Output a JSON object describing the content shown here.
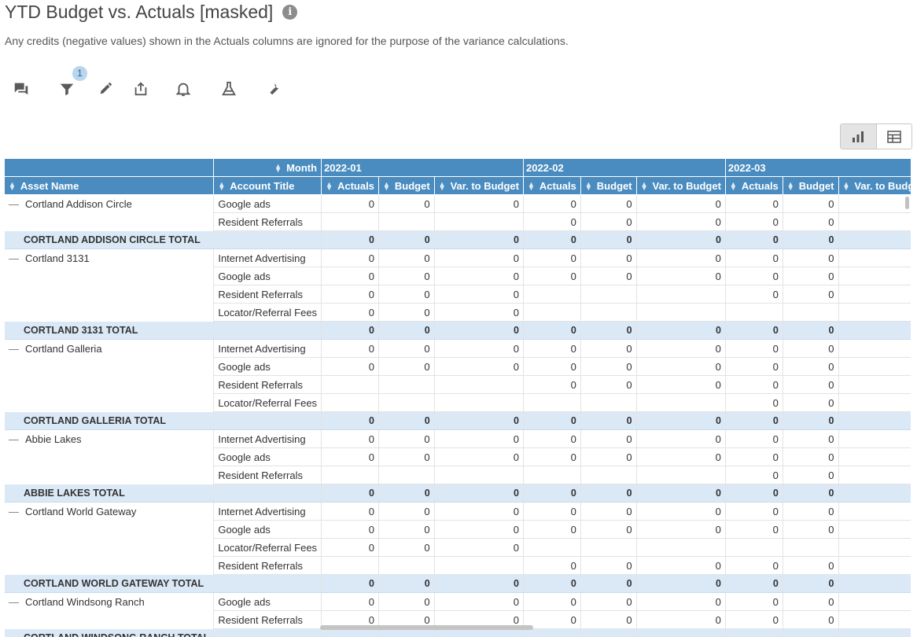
{
  "header": {
    "title": "YTD Budget vs. Actuals [masked]",
    "info_icon": "info-icon",
    "subtitle": "Any credits (negative values) shown in the Actuals columns are ignored for the purpose of the variance calculations."
  },
  "toolbar": {
    "items": [
      {
        "name": "comments-icon"
      },
      {
        "name": "filter-icon"
      },
      {
        "name": "edit-pencil-icon"
      },
      {
        "name": "export-share-icon"
      },
      {
        "name": "alert-bell-icon"
      },
      {
        "name": "lab-flask-icon"
      },
      {
        "name": "settings-wrench-icon"
      }
    ],
    "filter_count": "1"
  },
  "view_toggle": {
    "options": [
      "chart-view-icon",
      "table-view-icon"
    ],
    "active": "chart-view-icon"
  },
  "grid": {
    "pivot_label": "Month",
    "asset_header": "Asset Name",
    "account_header": "Account Title",
    "periods": [
      "2022-01",
      "2022-02",
      "2022-03"
    ],
    "measures": [
      "Actuals",
      "Budget",
      "Var. to Budget"
    ],
    "rows": [
      {
        "asset": "Cortland Addison Circle",
        "account": "Google ads",
        "values": [
          "0",
          "0",
          "0",
          "0",
          "0",
          "0",
          "0",
          "0",
          ""
        ]
      },
      {
        "asset": "",
        "account": "Resident Referrals",
        "values": [
          "",
          "",
          "",
          "0",
          "0",
          "0",
          "0",
          "0",
          ""
        ]
      },
      {
        "total": true,
        "asset": "CORTLAND ADDISON CIRCLE TOTAL",
        "values": [
          "0",
          "0",
          "0",
          "0",
          "0",
          "0",
          "0",
          "0",
          ""
        ]
      },
      {
        "asset": "Cortland 3131",
        "account": "Internet Advertising",
        "values": [
          "0",
          "0",
          "0",
          "0",
          "0",
          "0",
          "0",
          "0",
          ""
        ]
      },
      {
        "asset": "",
        "account": "Google ads",
        "values": [
          "0",
          "0",
          "0",
          "0",
          "0",
          "0",
          "0",
          "0",
          ""
        ]
      },
      {
        "asset": "",
        "account": "Resident Referrals",
        "values": [
          "0",
          "0",
          "0",
          "",
          "",
          "",
          "0",
          "0",
          ""
        ]
      },
      {
        "asset": "",
        "account": "Locator/Referral Fees",
        "values": [
          "0",
          "0",
          "0",
          "",
          "",
          "",
          "",
          "",
          ""
        ]
      },
      {
        "total": true,
        "asset": "CORTLAND 3131 TOTAL",
        "values": [
          "0",
          "0",
          "0",
          "0",
          "0",
          "0",
          "0",
          "0",
          ""
        ]
      },
      {
        "asset": "Cortland Galleria",
        "account": "Internet Advertising",
        "values": [
          "0",
          "0",
          "0",
          "0",
          "0",
          "0",
          "0",
          "0",
          ""
        ]
      },
      {
        "asset": "",
        "account": "Google ads",
        "values": [
          "0",
          "0",
          "0",
          "0",
          "0",
          "0",
          "0",
          "0",
          ""
        ]
      },
      {
        "asset": "",
        "account": "Resident Referrals",
        "values": [
          "",
          "",
          "",
          "0",
          "0",
          "0",
          "0",
          "0",
          ""
        ]
      },
      {
        "asset": "",
        "account": "Locator/Referral Fees",
        "values": [
          "",
          "",
          "",
          "",
          "",
          "",
          "0",
          "0",
          ""
        ]
      },
      {
        "total": true,
        "asset": "CORTLAND GALLERIA TOTAL",
        "values": [
          "0",
          "0",
          "0",
          "0",
          "0",
          "0",
          "0",
          "0",
          ""
        ]
      },
      {
        "asset": "Abbie Lakes",
        "account": "Internet Advertising",
        "values": [
          "0",
          "0",
          "0",
          "0",
          "0",
          "0",
          "0",
          "0",
          ""
        ]
      },
      {
        "asset": "",
        "account": "Google ads",
        "values": [
          "0",
          "0",
          "0",
          "0",
          "0",
          "0",
          "0",
          "0",
          ""
        ]
      },
      {
        "asset": "",
        "account": "Resident Referrals",
        "values": [
          "",
          "",
          "",
          "",
          "",
          "",
          "0",
          "0",
          ""
        ]
      },
      {
        "total": true,
        "asset": "ABBIE LAKES TOTAL",
        "values": [
          "0",
          "0",
          "0",
          "0",
          "0",
          "0",
          "0",
          "0",
          ""
        ]
      },
      {
        "asset": "Cortland World Gateway",
        "account": "Internet Advertising",
        "values": [
          "0",
          "0",
          "0",
          "0",
          "0",
          "0",
          "0",
          "0",
          ""
        ]
      },
      {
        "asset": "",
        "account": "Google ads",
        "values": [
          "0",
          "0",
          "0",
          "0",
          "0",
          "0",
          "0",
          "0",
          ""
        ]
      },
      {
        "asset": "",
        "account": "Locator/Referral Fees",
        "values": [
          "0",
          "0",
          "0",
          "",
          "",
          "",
          "",
          "",
          ""
        ]
      },
      {
        "asset": "",
        "account": "Resident Referrals",
        "values": [
          "",
          "",
          "",
          "0",
          "0",
          "0",
          "0",
          "0",
          ""
        ]
      },
      {
        "total": true,
        "asset": "CORTLAND WORLD GATEWAY TOTAL",
        "values": [
          "0",
          "0",
          "0",
          "0",
          "0",
          "0",
          "0",
          "0",
          ""
        ]
      },
      {
        "asset": "Cortland Windsong Ranch",
        "account": "Google ads",
        "values": [
          "0",
          "0",
          "0",
          "0",
          "0",
          "0",
          "0",
          "0",
          ""
        ]
      },
      {
        "asset": "",
        "account": "Resident Referrals",
        "values": [
          "0",
          "0",
          "0",
          "0",
          "0",
          "0",
          "0",
          "0",
          ""
        ]
      },
      {
        "total": true,
        "asset": "CORTLAND WINDSONG RANCH TOTAL",
        "values": [
          "",
          "",
          "",
          "",
          "",
          "",
          "",
          "",
          ""
        ]
      }
    ]
  },
  "colors": {
    "header_bg": "#4a8cc0",
    "total_row_bg": "#dbe9f7"
  }
}
